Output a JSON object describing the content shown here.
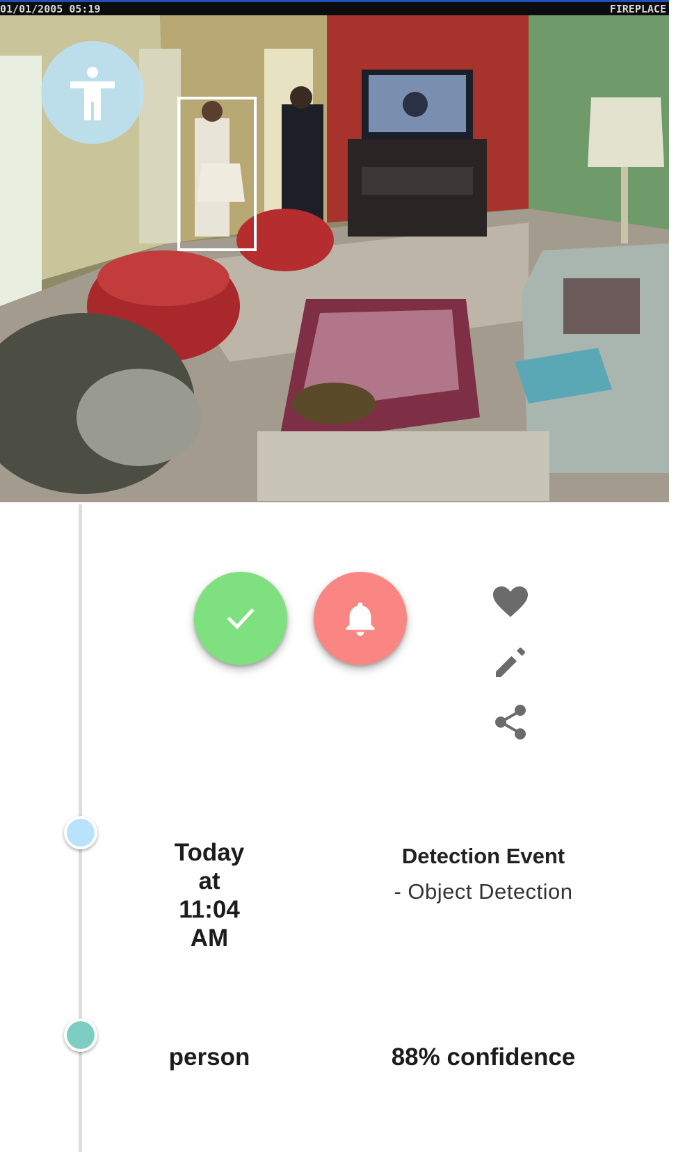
{
  "snapshot": {
    "overlay_timestamp": "01/01/2005 05:19",
    "overlay_camera_name": "FIREPLACE"
  },
  "actions": {
    "acknowledge_icon": "check-icon",
    "alarm_icon": "bell-icon",
    "favorite_icon": "heart-icon",
    "edit_icon": "pencil-icon",
    "share_icon": "share-icon",
    "acknowledge_color": "#7ee07e",
    "alarm_color": "#f98683",
    "icon_color": "#6b6b6b"
  },
  "event": {
    "time_line1": "Today",
    "time_line2": "at",
    "time_line3": "11:04",
    "time_line4": "AM",
    "title": "Detection Event",
    "subtitle": "- Object Detection"
  },
  "detection": {
    "object": "person",
    "confidence": "88% confidence"
  },
  "timeline": {
    "event_dot_color": "#b9e2fb",
    "detection_dot_color": "#7ecdc3"
  }
}
